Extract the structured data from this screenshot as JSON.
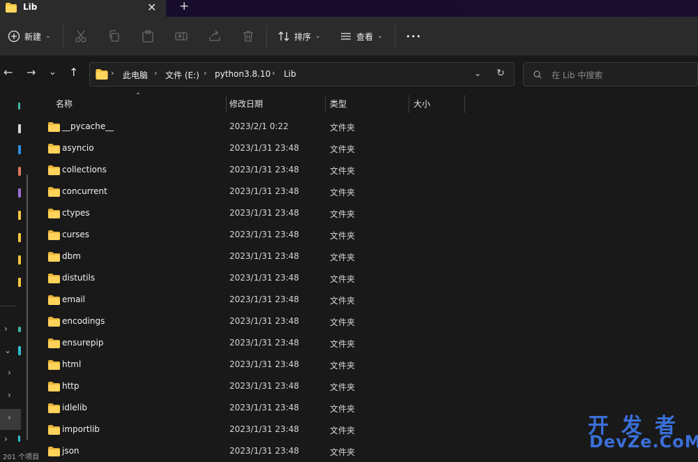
{
  "tab": {
    "title": "Lib",
    "close": "✕",
    "new": "+"
  },
  "toolbar": {
    "new_label": "新建",
    "sort_label": "排序",
    "view_label": "查看",
    "more_label": "•••"
  },
  "address": {
    "crumbs": [
      "此电脑",
      "文件 (E:)",
      "python3.8.10",
      "Lib"
    ]
  },
  "search": {
    "placeholder": "在 Lib 中搜索"
  },
  "columns": {
    "name": "名称",
    "date": "修改日期",
    "type": "类型",
    "size": "大小"
  },
  "files": [
    {
      "name": "__pycache__",
      "date": "2023/2/1 0:22",
      "type": "文件夹"
    },
    {
      "name": "asyncio",
      "date": "2023/1/31 23:48",
      "type": "文件夹"
    },
    {
      "name": "collections",
      "date": "2023/1/31 23:48",
      "type": "文件夹"
    },
    {
      "name": "concurrent",
      "date": "2023/1/31 23:48",
      "type": "文件夹"
    },
    {
      "name": "ctypes",
      "date": "2023/1/31 23:48",
      "type": "文件夹"
    },
    {
      "name": "curses",
      "date": "2023/1/31 23:48",
      "type": "文件夹"
    },
    {
      "name": "dbm",
      "date": "2023/1/31 23:48",
      "type": "文件夹"
    },
    {
      "name": "distutils",
      "date": "2023/1/31 23:48",
      "type": "文件夹"
    },
    {
      "name": "email",
      "date": "2023/1/31 23:48",
      "type": "文件夹"
    },
    {
      "name": "encodings",
      "date": "2023/1/31 23:48",
      "type": "文件夹"
    },
    {
      "name": "ensurepip",
      "date": "2023/1/31 23:48",
      "type": "文件夹"
    },
    {
      "name": "html",
      "date": "2023/1/31 23:48",
      "type": "文件夹"
    },
    {
      "name": "http",
      "date": "2023/1/31 23:48",
      "type": "文件夹"
    },
    {
      "name": "idlelib",
      "date": "2023/1/31 23:48",
      "type": "文件夹"
    },
    {
      "name": "importlib",
      "date": "2023/1/31 23:48",
      "type": "文件夹"
    },
    {
      "name": "json",
      "date": "2023/1/31 23:48",
      "type": "文件夹"
    }
  ],
  "watermark": {
    "top": "开发者",
    "bottom": "DevZe.CoM"
  },
  "status": "201 个项目"
}
